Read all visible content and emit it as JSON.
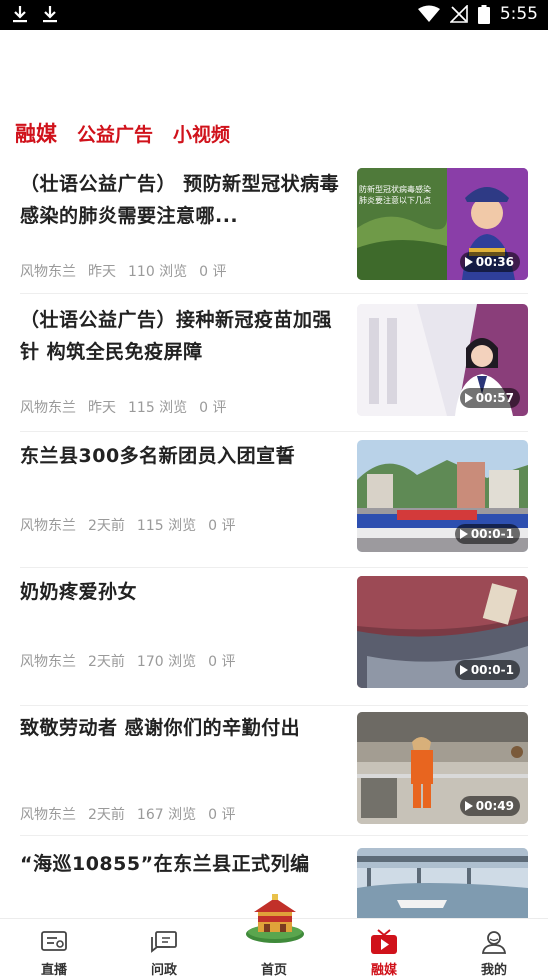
{
  "status_bar": {
    "time": "5:55",
    "icons": [
      "download-icon",
      "download-icon",
      "wifi-icon",
      "no-signal-icon",
      "battery-icon"
    ]
  },
  "tabs": [
    {
      "label": "融媒",
      "active": true
    },
    {
      "label": "公益广告",
      "active": false
    },
    {
      "label": "小视频",
      "active": false
    }
  ],
  "feed": [
    {
      "title": "（壮语公益广告） 预防新型冠状病毒感染的肺炎需要注意哪...",
      "source": "风物东兰",
      "time": "昨天",
      "views": "110 浏览",
      "comments": "0 评",
      "duration": "00:36"
    },
    {
      "title": "（壮语公益广告）接种新冠疫苗加强针 构筑全民免疫屏障",
      "source": "风物东兰",
      "time": "昨天",
      "views": "115 浏览",
      "comments": "0 评",
      "duration": "00:57"
    },
    {
      "title": "东兰县300多名新团员入团宣誓",
      "source": "风物东兰",
      "time": "2天前",
      "views": "115 浏览",
      "comments": "0 评",
      "duration": "00:0-1"
    },
    {
      "title": "奶奶疼爱孙女",
      "source": "风物东兰",
      "time": "2天前",
      "views": "170 浏览",
      "comments": "0 评",
      "duration": "00:0-1"
    },
    {
      "title": "致敬劳动者 感谢你们的辛勤付出",
      "source": "风物东兰",
      "time": "2天前",
      "views": "167 浏览",
      "comments": "0 评",
      "duration": "00:49"
    },
    {
      "title": "“海巡10855”在东兰县正式列编",
      "source": "",
      "time": "",
      "views": "",
      "comments": "",
      "duration": ""
    }
  ],
  "thumb_text": {
    "t0": "防新型冠状病毒感染\n肺炎要注意以下几点"
  },
  "bottom_nav": [
    {
      "label": "直播",
      "icon": "live-tv-icon",
      "active": false
    },
    {
      "label": "问政",
      "icon": "inquiry-chat-icon",
      "active": false
    },
    {
      "label": "首页",
      "icon": "home-logo-icon",
      "active": false
    },
    {
      "label": "融媒",
      "icon": "video-play-icon",
      "active": true
    },
    {
      "label": "我的",
      "icon": "profile-icon",
      "active": false
    }
  ],
  "colors": {
    "accent": "#d0121b",
    "meta": "#9a9a9a"
  }
}
